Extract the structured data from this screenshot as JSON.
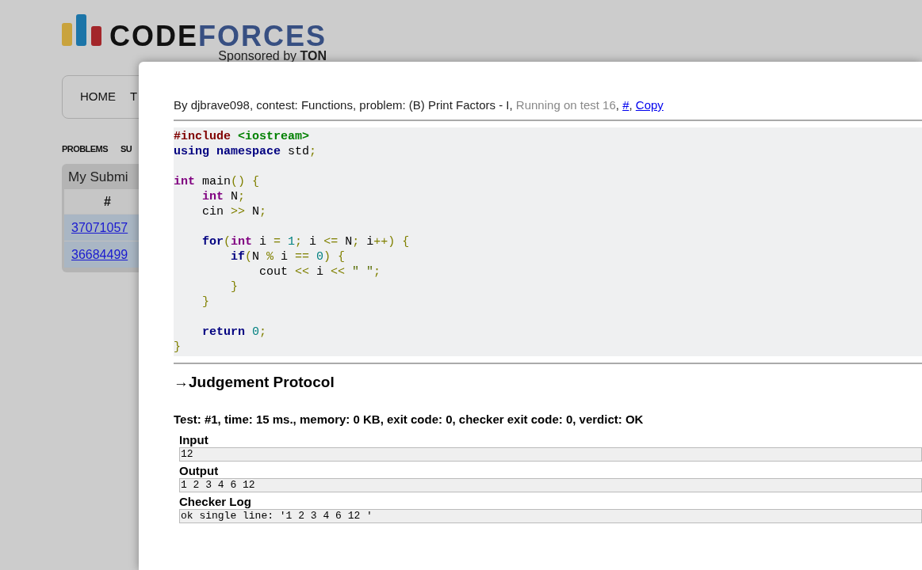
{
  "logo": {
    "word1": "CODE",
    "word2": "FORCES",
    "sponsor": "Sponsored by **TON**"
  },
  "nav": [
    "HOME",
    "T"
  ],
  "subnav": [
    "PROBLEMS",
    "SU"
  ],
  "panel": {
    "title": "My Submi",
    "column": "#",
    "rows": [
      "37071057",
      "36684499"
    ]
  },
  "modal": {
    "header": [
      {
        "text": "By djbrave098, contest: Functions, problem: (B) Print Factors - I, ",
        "kind": "plain"
      },
      {
        "text": "Running on test 16",
        "kind": "status"
      },
      {
        "text": ", ",
        "kind": "plain"
      },
      {
        "text": "#",
        "kind": "link"
      },
      {
        "text": ", ",
        "kind": "plain"
      },
      {
        "text": "Copy",
        "kind": "link"
      }
    ],
    "code": [
      {
        "kind": "code",
        "tokens": [
          {
            "text": "#include ",
            "kind": "preproc"
          },
          {
            "text": "<iostream>",
            "kind": "header"
          }
        ]
      },
      {
        "kind": "code",
        "tokens": [
          {
            "text": "using namespace",
            "kind": "keyword"
          },
          {
            "text": " std",
            "kind": "plain"
          },
          {
            "text": ";",
            "kind": "punct"
          }
        ]
      },
      {
        "kind": "blank"
      },
      {
        "kind": "code",
        "tokens": [
          {
            "text": "int",
            "kind": "type"
          },
          {
            "text": " main",
            "kind": "plain"
          },
          {
            "text": "() {",
            "kind": "punct"
          }
        ]
      },
      {
        "kind": "code",
        "tokens": [
          {
            "text": "    int",
            "kind": "type"
          },
          {
            "text": " N",
            "kind": "plain"
          },
          {
            "text": ";",
            "kind": "punct"
          }
        ]
      },
      {
        "kind": "code",
        "tokens": [
          {
            "text": "    cin ",
            "kind": "plain"
          },
          {
            "text": ">>",
            "kind": "punct"
          },
          {
            "text": " N",
            "kind": "plain"
          },
          {
            "text": ";",
            "kind": "punct"
          }
        ]
      },
      {
        "kind": "blank"
      },
      {
        "kind": "code",
        "tokens": [
          {
            "text": "    for",
            "kind": "keyword"
          },
          {
            "text": "(",
            "kind": "punct"
          },
          {
            "text": "int",
            "kind": "type"
          },
          {
            "text": " i ",
            "kind": "plain"
          },
          {
            "text": "= ",
            "kind": "punct"
          },
          {
            "text": "1",
            "kind": "number"
          },
          {
            "text": ";",
            "kind": "punct"
          },
          {
            "text": " i ",
            "kind": "plain"
          },
          {
            "text": "<=",
            "kind": "punct"
          },
          {
            "text": " N",
            "kind": "plain"
          },
          {
            "text": ";",
            "kind": "punct"
          },
          {
            "text": " i",
            "kind": "plain"
          },
          {
            "text": "++) {",
            "kind": "punct"
          }
        ]
      },
      {
        "kind": "code",
        "tokens": [
          {
            "text": "        if",
            "kind": "keyword"
          },
          {
            "text": "(",
            "kind": "punct"
          },
          {
            "text": "N ",
            "kind": "plain"
          },
          {
            "text": "%",
            "kind": "punct"
          },
          {
            "text": " i ",
            "kind": "plain"
          },
          {
            "text": "== ",
            "kind": "punct"
          },
          {
            "text": "0",
            "kind": "number"
          },
          {
            "text": ") {",
            "kind": "punct"
          }
        ]
      },
      {
        "kind": "code",
        "tokens": [
          {
            "text": "            cout ",
            "kind": "plain"
          },
          {
            "text": "<<",
            "kind": "punct"
          },
          {
            "text": " i ",
            "kind": "plain"
          },
          {
            "text": "<< ",
            "kind": "punct"
          },
          {
            "text": "\" \"",
            "kind": "string"
          },
          {
            "text": ";",
            "kind": "punct"
          }
        ]
      },
      {
        "kind": "code",
        "tokens": [
          {
            "text": "        }",
            "kind": "punct"
          }
        ]
      },
      {
        "kind": "code",
        "tokens": [
          {
            "text": "    }",
            "kind": "punct"
          }
        ]
      },
      {
        "kind": "blank"
      },
      {
        "kind": "code",
        "tokens": [
          {
            "text": "    return",
            "kind": "keyword"
          },
          {
            "text": " 0",
            "kind": "number"
          },
          {
            "text": ";",
            "kind": "punct"
          }
        ]
      },
      {
        "kind": "code",
        "tokens": [
          {
            "text": "}",
            "kind": "punct"
          }
        ]
      }
    ],
    "protocol_title": "→Judgement Protocol",
    "tests": [
      {
        "summary": "Test: #1, time: 15 ms., memory: 0 KB, exit code: 0, checker exit code: 0, verdict: OK",
        "sections": [
          {
            "label": "Input",
            "value": "12"
          },
          {
            "label": "Output",
            "value": "1 2 3 4 6 12"
          },
          {
            "label": "Checker Log",
            "value": "ok single line: '1 2 3 4 6 12 '"
          }
        ]
      }
    ]
  }
}
